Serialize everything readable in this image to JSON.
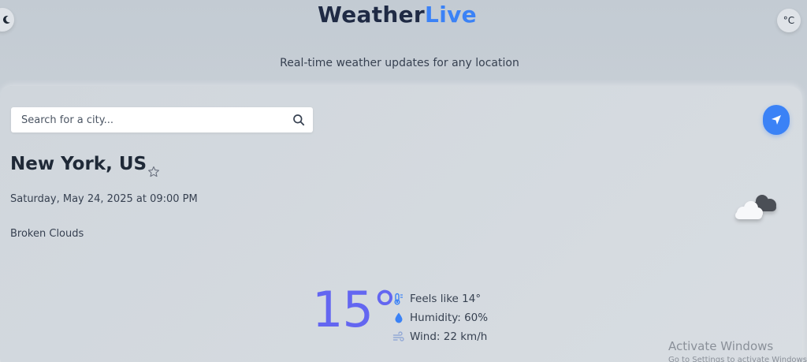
{
  "header": {
    "logo_primary": "Weather",
    "logo_accent": "Live",
    "subtitle": "Real-time weather updates for any location",
    "unit_toggle": "°C"
  },
  "search": {
    "placeholder": "Search for a city..."
  },
  "current": {
    "city": "New York, US",
    "date": "Saturday, May 24, 2025 at 09:00 PM",
    "condition": "Broken Clouds",
    "temperature": "15°",
    "feels_like": "Feels like 14°",
    "humidity": "Humidity: 60%",
    "wind": "Wind: 22 km/h"
  },
  "icons": {
    "theme": "moon-icon",
    "search": "search-icon",
    "locate": "location-arrow-icon",
    "favorite": "star-icon",
    "weather": "broken-clouds-icon",
    "feels": "thermometer-icon",
    "humidity": "droplet-icon",
    "wind": "wind-icon"
  },
  "colors": {
    "accent": "#3b82f6",
    "temperature": "#6366f1"
  },
  "watermark": {
    "title": "Activate Windows",
    "subtitle": "Go to Settings to activate Windows."
  }
}
